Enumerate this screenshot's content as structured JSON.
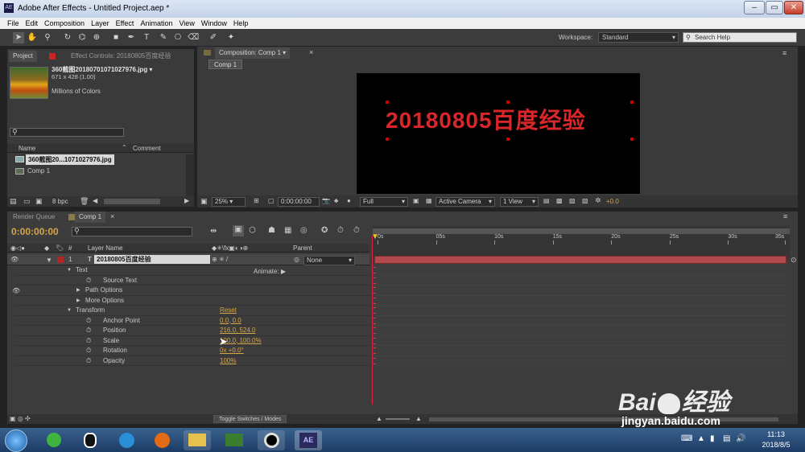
{
  "window": {
    "title": "Adobe After Effects - Untitled Project.aep *",
    "app_icon": "AE"
  },
  "menu": [
    "File",
    "Edit",
    "Composition",
    "Layer",
    "Effect",
    "Animation",
    "View",
    "Window",
    "Help"
  ],
  "toolbar": {
    "workspace_label": "Workspace:",
    "workspace_value": "Standard",
    "search_placeholder": "Search Help"
  },
  "project_panel": {
    "tab_project": "Project",
    "tab_effect_controls": "Effect Controls: 20180805百度经验",
    "file_name": "360截图20180701071027976.jpg ▾",
    "file_dims": "671 x 428 (1.00)",
    "file_colors": "Millions of Colors",
    "col_name": "Name",
    "col_comment": "Comment",
    "items": [
      {
        "name": "360截图20...1071027976.jpg",
        "selected": true
      },
      {
        "name": "Comp 1",
        "selected": false
      }
    ],
    "bpc": "8 bpc"
  },
  "comp_panel": {
    "tab_title": "Composition: Comp 1",
    "breadcrumb": "Comp 1",
    "canvas_text": "20180805百度经验",
    "zoom": "25%",
    "timecode": "0:00:00:00",
    "resolution": "Full",
    "camera": "Active Camera",
    "view": "1 View",
    "exposure": "+0.0"
  },
  "timeline": {
    "tab_render_queue": "Render Queue",
    "tab_comp": "Comp 1",
    "timecode": "0:00:00:00",
    "search_placeholder": "",
    "col_layer_name": "Layer Name",
    "col_parent": "Parent",
    "layer_index": "1",
    "layer_type_icon": "T",
    "layer_name": "20180805百度经验",
    "parent_value": "None",
    "animate_label": "Animate:",
    "ruler": [
      "0s",
      "05s",
      "10s",
      "15s",
      "20s",
      "25s",
      "30s",
      "35s"
    ],
    "properties": [
      {
        "label": "Text",
        "indent": 1,
        "twirl": "down",
        "value": ""
      },
      {
        "label": "Source Text",
        "indent": 3,
        "twirl": "",
        "value": "",
        "stopwatch": true
      },
      {
        "label": "Path Options",
        "indent": 2,
        "twirl": "right",
        "value": ""
      },
      {
        "label": "More Options",
        "indent": 2,
        "twirl": "right",
        "value": ""
      },
      {
        "label": "Transform",
        "indent": 1,
        "twirl": "down",
        "value": "Reset"
      },
      {
        "label": "Anchor Point",
        "indent": 3,
        "twirl": "",
        "value": "0.0, 0.0",
        "stopwatch": true
      },
      {
        "label": "Position",
        "indent": 3,
        "twirl": "",
        "value": "216.0, 524.0",
        "stopwatch": true
      },
      {
        "label": "Scale",
        "indent": 3,
        "twirl": "",
        "value": "100.0, 100.0%",
        "stopwatch": true
      },
      {
        "label": "Rotation",
        "indent": 3,
        "twirl": "",
        "value": "0x +0.0°",
        "stopwatch": true
      },
      {
        "label": "Opacity",
        "indent": 3,
        "twirl": "",
        "value": "100%",
        "stopwatch": true
      }
    ],
    "toggle_label": "Toggle Switches / Modes"
  },
  "taskbar": {
    "time": "11:13",
    "date": "2018/8/5"
  },
  "watermark": {
    "brand": "Bai",
    "brand2": "经验",
    "url": "jingyan.baidu.com"
  },
  "colors": {
    "accent": "#d6a64a",
    "layer_bar": "#b14a4a",
    "text_red": "#d8262a"
  }
}
